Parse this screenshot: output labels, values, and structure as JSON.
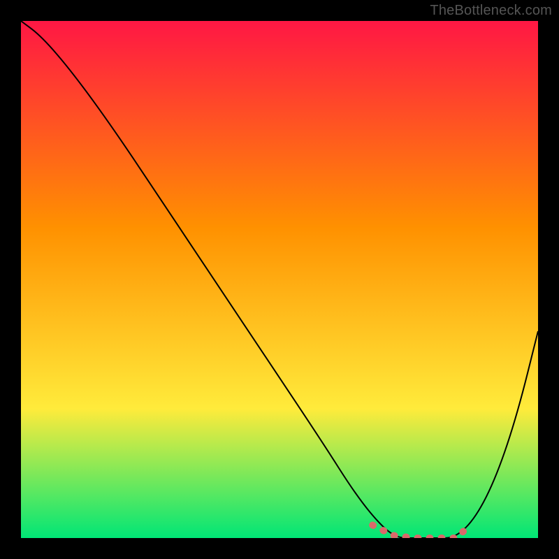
{
  "watermark": "TheBottleneck.com",
  "chart_data": {
    "type": "line",
    "title": "",
    "xlabel": "",
    "ylabel": "",
    "xlim": [
      0,
      100
    ],
    "ylim": [
      0,
      100
    ],
    "grid": false,
    "background_gradient": {
      "top_color": "#ff1744",
      "mid_upper_color": "#ff9100",
      "mid_lower_color": "#ffeb3b",
      "bottom_color": "#00e676"
    },
    "series": [
      {
        "name": "bottleneck-curve",
        "color": "#000000",
        "stroke_width": 2,
        "x": [
          0,
          4,
          10,
          18,
          28,
          38,
          48,
          58,
          65,
          70,
          73,
          76,
          80,
          84,
          88,
          92,
          96,
          100
        ],
        "values": [
          100,
          97,
          90,
          79,
          64,
          49,
          34,
          19,
          8,
          2,
          0,
          0,
          0,
          0,
          4,
          12,
          24,
          40
        ]
      },
      {
        "name": "flat-minimum-highlight",
        "color": "#d96a6a",
        "stroke_width": 10,
        "stroke_linecap": "round",
        "stroke_dasharray": "1 16",
        "x": [
          68,
          72,
          76,
          80,
          84,
          87
        ],
        "values": [
          2.5,
          0.5,
          0,
          0,
          0,
          2.5
        ]
      }
    ]
  }
}
